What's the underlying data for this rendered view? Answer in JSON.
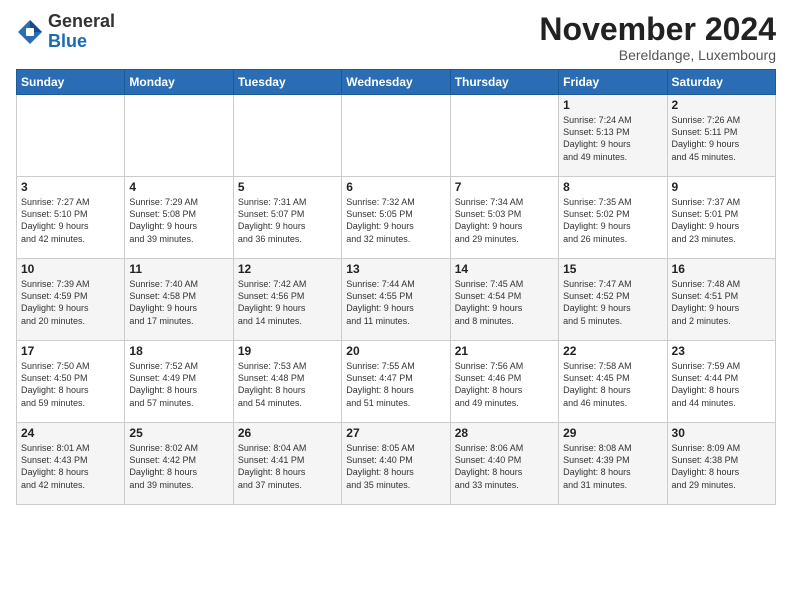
{
  "header": {
    "logo_general": "General",
    "logo_blue": "Blue",
    "month_title": "November 2024",
    "location": "Bereldange, Luxembourg"
  },
  "days_of_week": [
    "Sunday",
    "Monday",
    "Tuesday",
    "Wednesday",
    "Thursday",
    "Friday",
    "Saturday"
  ],
  "weeks": [
    [
      {
        "day": "",
        "info": ""
      },
      {
        "day": "",
        "info": ""
      },
      {
        "day": "",
        "info": ""
      },
      {
        "day": "",
        "info": ""
      },
      {
        "day": "",
        "info": ""
      },
      {
        "day": "1",
        "info": "Sunrise: 7:24 AM\nSunset: 5:13 PM\nDaylight: 9 hours\nand 49 minutes."
      },
      {
        "day": "2",
        "info": "Sunrise: 7:26 AM\nSunset: 5:11 PM\nDaylight: 9 hours\nand 45 minutes."
      }
    ],
    [
      {
        "day": "3",
        "info": "Sunrise: 7:27 AM\nSunset: 5:10 PM\nDaylight: 9 hours\nand 42 minutes."
      },
      {
        "day": "4",
        "info": "Sunrise: 7:29 AM\nSunset: 5:08 PM\nDaylight: 9 hours\nand 39 minutes."
      },
      {
        "day": "5",
        "info": "Sunrise: 7:31 AM\nSunset: 5:07 PM\nDaylight: 9 hours\nand 36 minutes."
      },
      {
        "day": "6",
        "info": "Sunrise: 7:32 AM\nSunset: 5:05 PM\nDaylight: 9 hours\nand 32 minutes."
      },
      {
        "day": "7",
        "info": "Sunrise: 7:34 AM\nSunset: 5:03 PM\nDaylight: 9 hours\nand 29 minutes."
      },
      {
        "day": "8",
        "info": "Sunrise: 7:35 AM\nSunset: 5:02 PM\nDaylight: 9 hours\nand 26 minutes."
      },
      {
        "day": "9",
        "info": "Sunrise: 7:37 AM\nSunset: 5:01 PM\nDaylight: 9 hours\nand 23 minutes."
      }
    ],
    [
      {
        "day": "10",
        "info": "Sunrise: 7:39 AM\nSunset: 4:59 PM\nDaylight: 9 hours\nand 20 minutes."
      },
      {
        "day": "11",
        "info": "Sunrise: 7:40 AM\nSunset: 4:58 PM\nDaylight: 9 hours\nand 17 minutes."
      },
      {
        "day": "12",
        "info": "Sunrise: 7:42 AM\nSunset: 4:56 PM\nDaylight: 9 hours\nand 14 minutes."
      },
      {
        "day": "13",
        "info": "Sunrise: 7:44 AM\nSunset: 4:55 PM\nDaylight: 9 hours\nand 11 minutes."
      },
      {
        "day": "14",
        "info": "Sunrise: 7:45 AM\nSunset: 4:54 PM\nDaylight: 9 hours\nand 8 minutes."
      },
      {
        "day": "15",
        "info": "Sunrise: 7:47 AM\nSunset: 4:52 PM\nDaylight: 9 hours\nand 5 minutes."
      },
      {
        "day": "16",
        "info": "Sunrise: 7:48 AM\nSunset: 4:51 PM\nDaylight: 9 hours\nand 2 minutes."
      }
    ],
    [
      {
        "day": "17",
        "info": "Sunrise: 7:50 AM\nSunset: 4:50 PM\nDaylight: 8 hours\nand 59 minutes."
      },
      {
        "day": "18",
        "info": "Sunrise: 7:52 AM\nSunset: 4:49 PM\nDaylight: 8 hours\nand 57 minutes."
      },
      {
        "day": "19",
        "info": "Sunrise: 7:53 AM\nSunset: 4:48 PM\nDaylight: 8 hours\nand 54 minutes."
      },
      {
        "day": "20",
        "info": "Sunrise: 7:55 AM\nSunset: 4:47 PM\nDaylight: 8 hours\nand 51 minutes."
      },
      {
        "day": "21",
        "info": "Sunrise: 7:56 AM\nSunset: 4:46 PM\nDaylight: 8 hours\nand 49 minutes."
      },
      {
        "day": "22",
        "info": "Sunrise: 7:58 AM\nSunset: 4:45 PM\nDaylight: 8 hours\nand 46 minutes."
      },
      {
        "day": "23",
        "info": "Sunrise: 7:59 AM\nSunset: 4:44 PM\nDaylight: 8 hours\nand 44 minutes."
      }
    ],
    [
      {
        "day": "24",
        "info": "Sunrise: 8:01 AM\nSunset: 4:43 PM\nDaylight: 8 hours\nand 42 minutes."
      },
      {
        "day": "25",
        "info": "Sunrise: 8:02 AM\nSunset: 4:42 PM\nDaylight: 8 hours\nand 39 minutes."
      },
      {
        "day": "26",
        "info": "Sunrise: 8:04 AM\nSunset: 4:41 PM\nDaylight: 8 hours\nand 37 minutes."
      },
      {
        "day": "27",
        "info": "Sunrise: 8:05 AM\nSunset: 4:40 PM\nDaylight: 8 hours\nand 35 minutes."
      },
      {
        "day": "28",
        "info": "Sunrise: 8:06 AM\nSunset: 4:40 PM\nDaylight: 8 hours\nand 33 minutes."
      },
      {
        "day": "29",
        "info": "Sunrise: 8:08 AM\nSunset: 4:39 PM\nDaylight: 8 hours\nand 31 minutes."
      },
      {
        "day": "30",
        "info": "Sunrise: 8:09 AM\nSunset: 4:38 PM\nDaylight: 8 hours\nand 29 minutes."
      }
    ]
  ]
}
